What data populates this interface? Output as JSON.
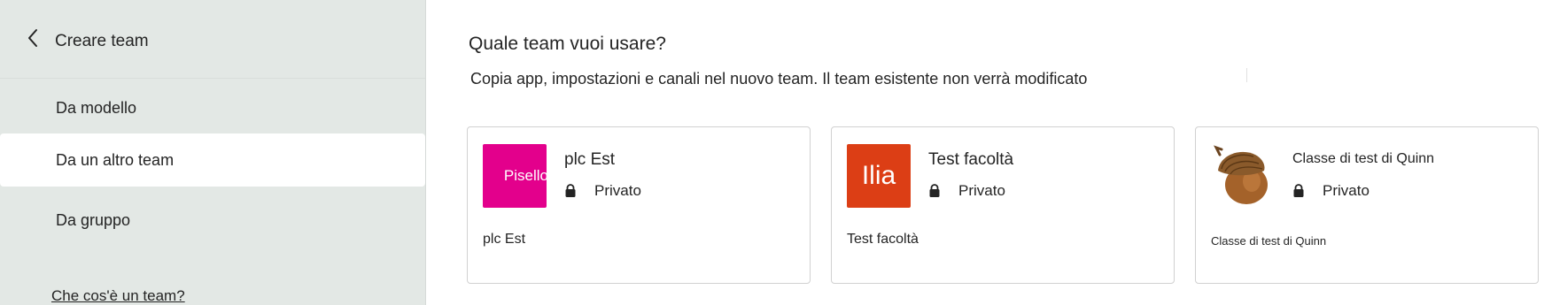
{
  "sidebar": {
    "title": "Creare team",
    "items": [
      {
        "label": "Da modello"
      },
      {
        "label": "Da un altro team"
      },
      {
        "label": "Da gruppo"
      }
    ],
    "help_link": "Che cos'è un team?"
  },
  "main": {
    "title": "Quale team vuoi usare?",
    "subtitle": "Copia app, impostazioni e canali nel nuovo team. Il team esistente non verrà modificato",
    "teams": [
      {
        "avatar_text": "Pisello",
        "avatar_color": "#e3008c",
        "name": "plc Est",
        "privacy": "Privato",
        "description": "plc Est"
      },
      {
        "avatar_text": "Ilia",
        "avatar_color": "#dc3e15",
        "name": "Test facoltà",
        "privacy": "Privato",
        "description": "Test facoltà"
      },
      {
        "avatar_icon": "acorn-icon",
        "name": "Classe di test di Quinn",
        "privacy": "Privato",
        "description": "Classe di test di Quinn"
      }
    ]
  },
  "colors": {
    "sidebar_bg": "#e3e8e5",
    "selected_item_bg": "#ffffff",
    "card_border": "#d1d1d1"
  }
}
